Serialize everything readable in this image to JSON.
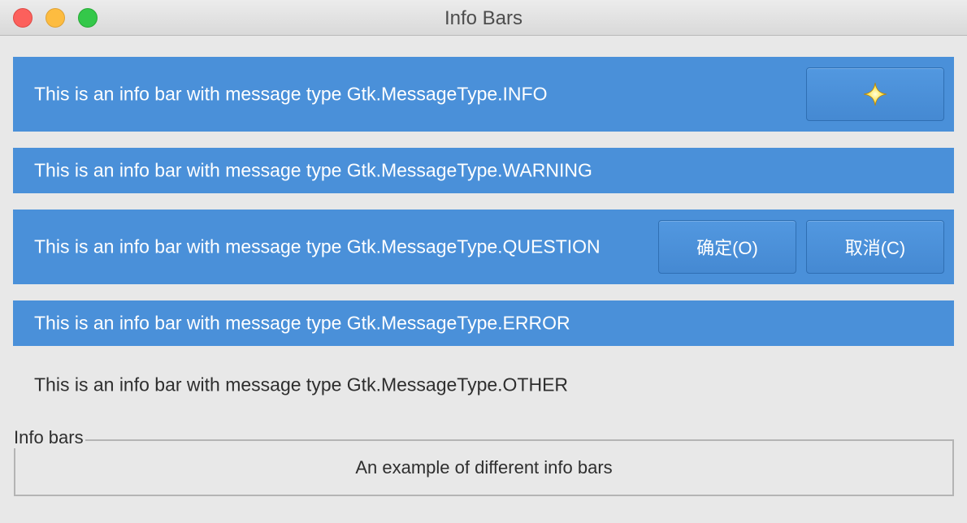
{
  "window": {
    "title": "Info Bars"
  },
  "info_bars": {
    "info": {
      "message": "This is an info bar with message type Gtk.MessageType.INFO",
      "button_icon": "sparkle-star-icon"
    },
    "warning": {
      "message": "This is an info bar with message type Gtk.MessageType.WARNING"
    },
    "question": {
      "message": "This is an info bar with message type Gtk.MessageType.QUESTION",
      "ok_label": "确定(O)",
      "cancel_label": "取消(C)"
    },
    "error": {
      "message": "This is an info bar with message type Gtk.MessageType.ERROR"
    },
    "other": {
      "message": "This is an info bar with message type Gtk.MessageType.OTHER"
    }
  },
  "frame": {
    "label": "Info bars",
    "content": "An example of different info bars"
  },
  "colors": {
    "bar_background": "#4a90d9",
    "window_background": "#e8e8e8",
    "close": "#fc605c",
    "minimize": "#fdbc40",
    "zoom": "#34c84a"
  }
}
